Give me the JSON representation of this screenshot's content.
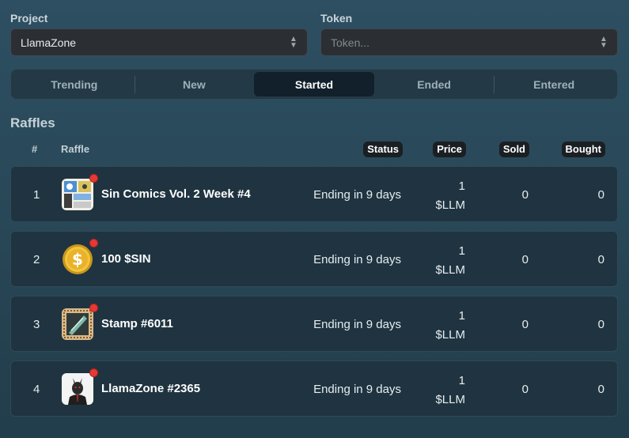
{
  "filters": {
    "project_label": "Project",
    "project_value": "LlamaZone",
    "token_label": "Token",
    "token_placeholder": "Token..."
  },
  "tabs": [
    {
      "label": "Trending",
      "active": false
    },
    {
      "label": "New",
      "active": false
    },
    {
      "label": "Started",
      "active": true
    },
    {
      "label": "Ended",
      "active": false
    },
    {
      "label": "Entered",
      "active": false
    }
  ],
  "section_title": "Raffles",
  "table": {
    "headers": {
      "index": "#",
      "raffle": "Raffle",
      "status": "Status",
      "price": "Price",
      "sold": "Sold",
      "bought": "Bought"
    },
    "rows": [
      {
        "index": "1",
        "name": "Sin Comics Vol. 2 Week #4",
        "status": "Ending in 9 days",
        "price_amount": "1",
        "price_token": "$LLM",
        "sold": "0",
        "bought": "0",
        "thumb_icon": "comic-thumbnail"
      },
      {
        "index": "2",
        "name": "100 $SIN",
        "status": "Ending in 9 days",
        "price_amount": "1",
        "price_token": "$LLM",
        "sold": "0",
        "bought": "0",
        "thumb_icon": "gold-coin-icon"
      },
      {
        "index": "3",
        "name": "Stamp #6011",
        "status": "Ending in 9 days",
        "price_amount": "1",
        "price_token": "$LLM",
        "sold": "0",
        "bought": "0",
        "thumb_icon": "stamp-thumbnail"
      },
      {
        "index": "4",
        "name": "LlamaZone #2365",
        "status": "Ending in 9 days",
        "price_amount": "1",
        "price_token": "$LLM",
        "sold": "0",
        "bought": "0",
        "thumb_icon": "llama-avatar-thumbnail"
      }
    ]
  },
  "colors": {
    "accent_dot": "#e53935",
    "active_tab_bg": "#11202a",
    "row_bg": "#1f3440"
  }
}
